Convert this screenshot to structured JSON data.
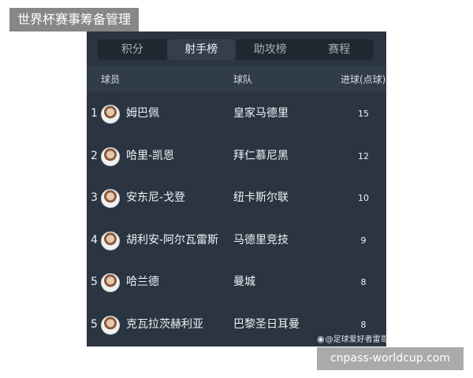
{
  "top_label": "世界杯赛事筹备管理",
  "tabs": [
    {
      "label": "积分"
    },
    {
      "label": "射手榜"
    },
    {
      "label": "助攻榜"
    },
    {
      "label": "赛程"
    }
  ],
  "active_tab": "射手榜",
  "header": {
    "player": "球员",
    "team": "球队",
    "goals": "进球(点球)"
  },
  "rows": [
    {
      "rank": "1",
      "player": "姆巴佩",
      "team": "皇家马德里",
      "goals": "15"
    },
    {
      "rank": "2",
      "player": "哈里-凯恩",
      "team": "拜仁慕尼黑",
      "goals": "12"
    },
    {
      "rank": "3",
      "player": "安东尼-戈登",
      "team": "纽卡斯尔联",
      "goals": "10"
    },
    {
      "rank": "4",
      "player": "胡利安-阿尔瓦雷斯",
      "team": "马德里竞技",
      "goals": "9"
    },
    {
      "rank": "5",
      "player": "哈兰德",
      "team": "曼城",
      "goals": "8"
    },
    {
      "rank": "5",
      "player": "克瓦拉茨赫利亚",
      "team": "巴黎圣日耳曼",
      "goals": "8"
    }
  ],
  "watermark": "@足球爱好者雷哥",
  "source": "cnpass-worldcup.com",
  "colors": {
    "panel_bg": "#2b3541",
    "tabs_bg": "#1f2730",
    "active_tab_bg": "#343f4c",
    "header_bg": "#313c49"
  }
}
